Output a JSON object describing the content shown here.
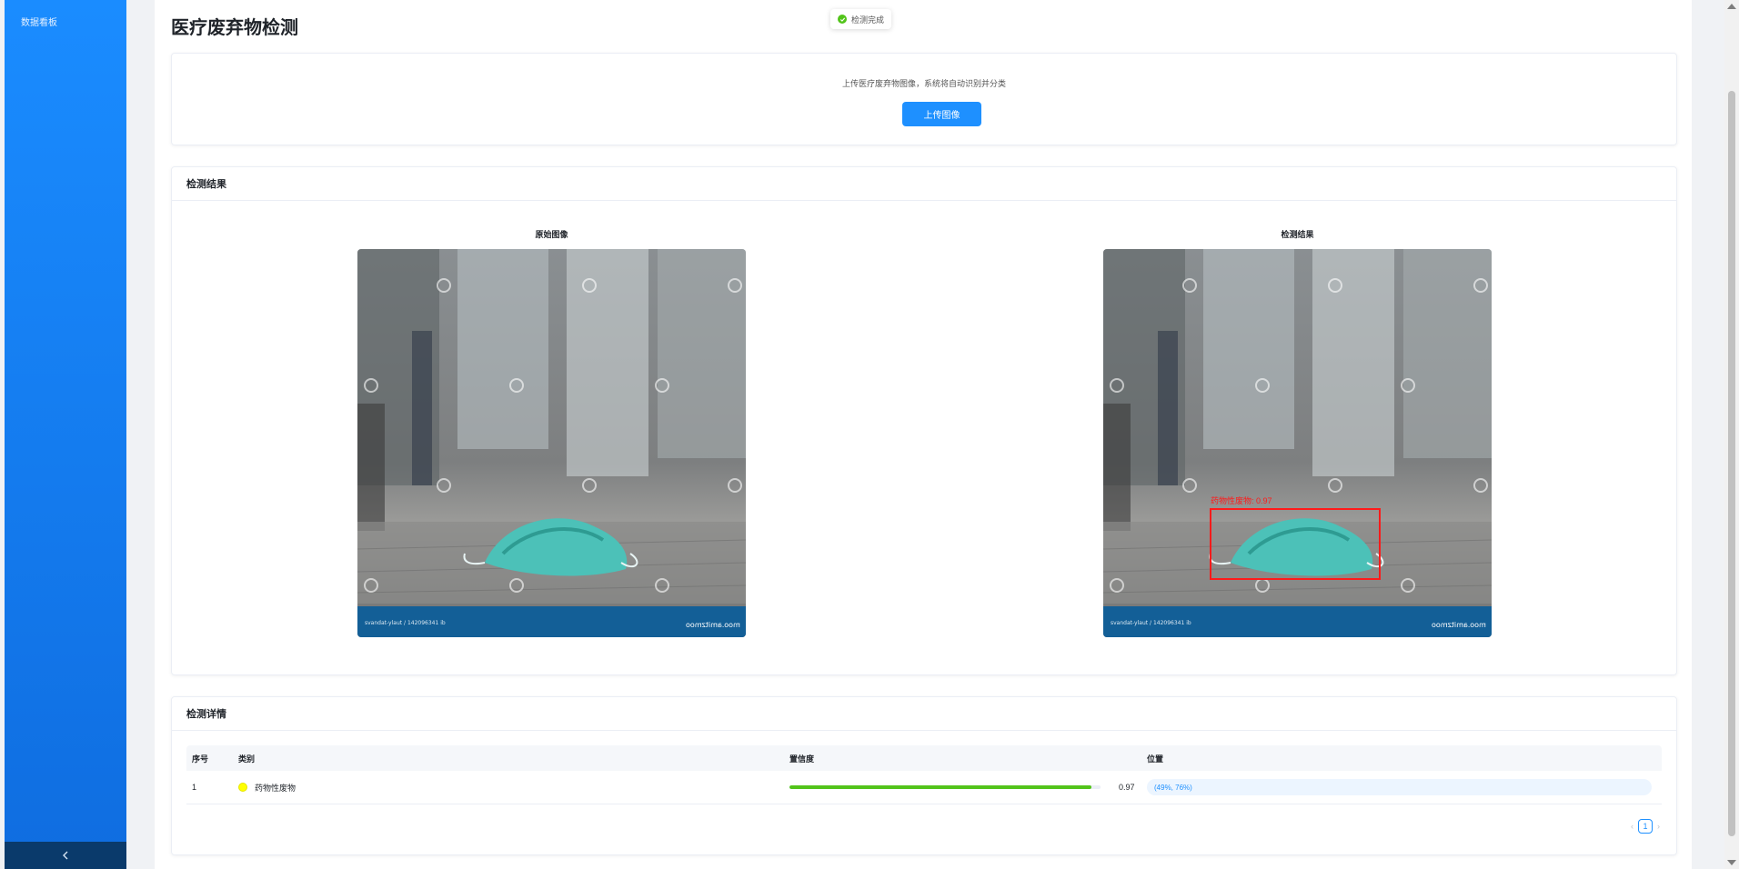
{
  "sidebar": {
    "items": [
      {
        "label": "数据看板"
      }
    ],
    "collapse_icon": "chevron-left-icon"
  },
  "page": {
    "title": "医疗废弃物检测"
  },
  "toast": {
    "text": "检测完成",
    "icon": "check-circle-icon",
    "color": "#52c41a"
  },
  "upload": {
    "hint": "上传医疗废弃物图像，系统将自动识别并分类",
    "button_label": "上传图像"
  },
  "result": {
    "header": "检测结果",
    "original_title": "原始图像",
    "detected_title": "检测结果",
    "watermark_left": "svandat-ylaut / 142096341 ib",
    "watermark_right": "moo.amitzmoo",
    "detection_label": "药物性废物: 0.97",
    "box_color": "#ff1a1a"
  },
  "details": {
    "header": "检测详情",
    "columns": [
      "序号",
      "类别",
      "置信度",
      "位置"
    ],
    "rows": [
      {
        "index": "1",
        "category": "药物性废物",
        "dot_color": "#ffff00",
        "confidence": 0.97,
        "confidence_text": "0.97",
        "position": "(49%, 76%)"
      }
    ],
    "pagination": {
      "current": "1",
      "prev": "‹",
      "next": "›"
    }
  }
}
